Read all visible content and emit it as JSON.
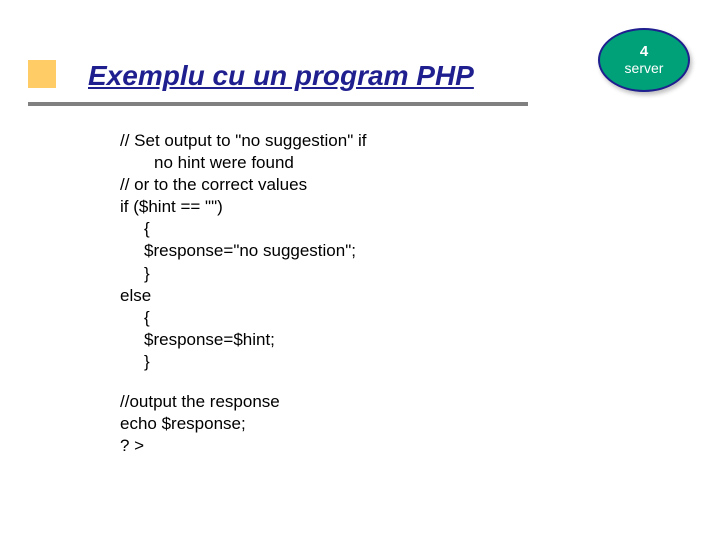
{
  "title": "Exemplu cu un program PHP",
  "badge": {
    "number": "4",
    "label": "server"
  },
  "code": {
    "l01": "// Set output to \"no suggestion\" if",
    "l02": "no hint were found",
    "l03": "// or to the correct values",
    "l04": "if ($hint == \"\")",
    "l05": "{",
    "l06": "$response=\"no suggestion\";",
    "l07": "}",
    "l08": "else",
    "l09": "{",
    "l10": "$response=$hint;",
    "l11": "}",
    "l12": "//output the response",
    "l13": "echo $response;",
    "l14": "? >"
  }
}
